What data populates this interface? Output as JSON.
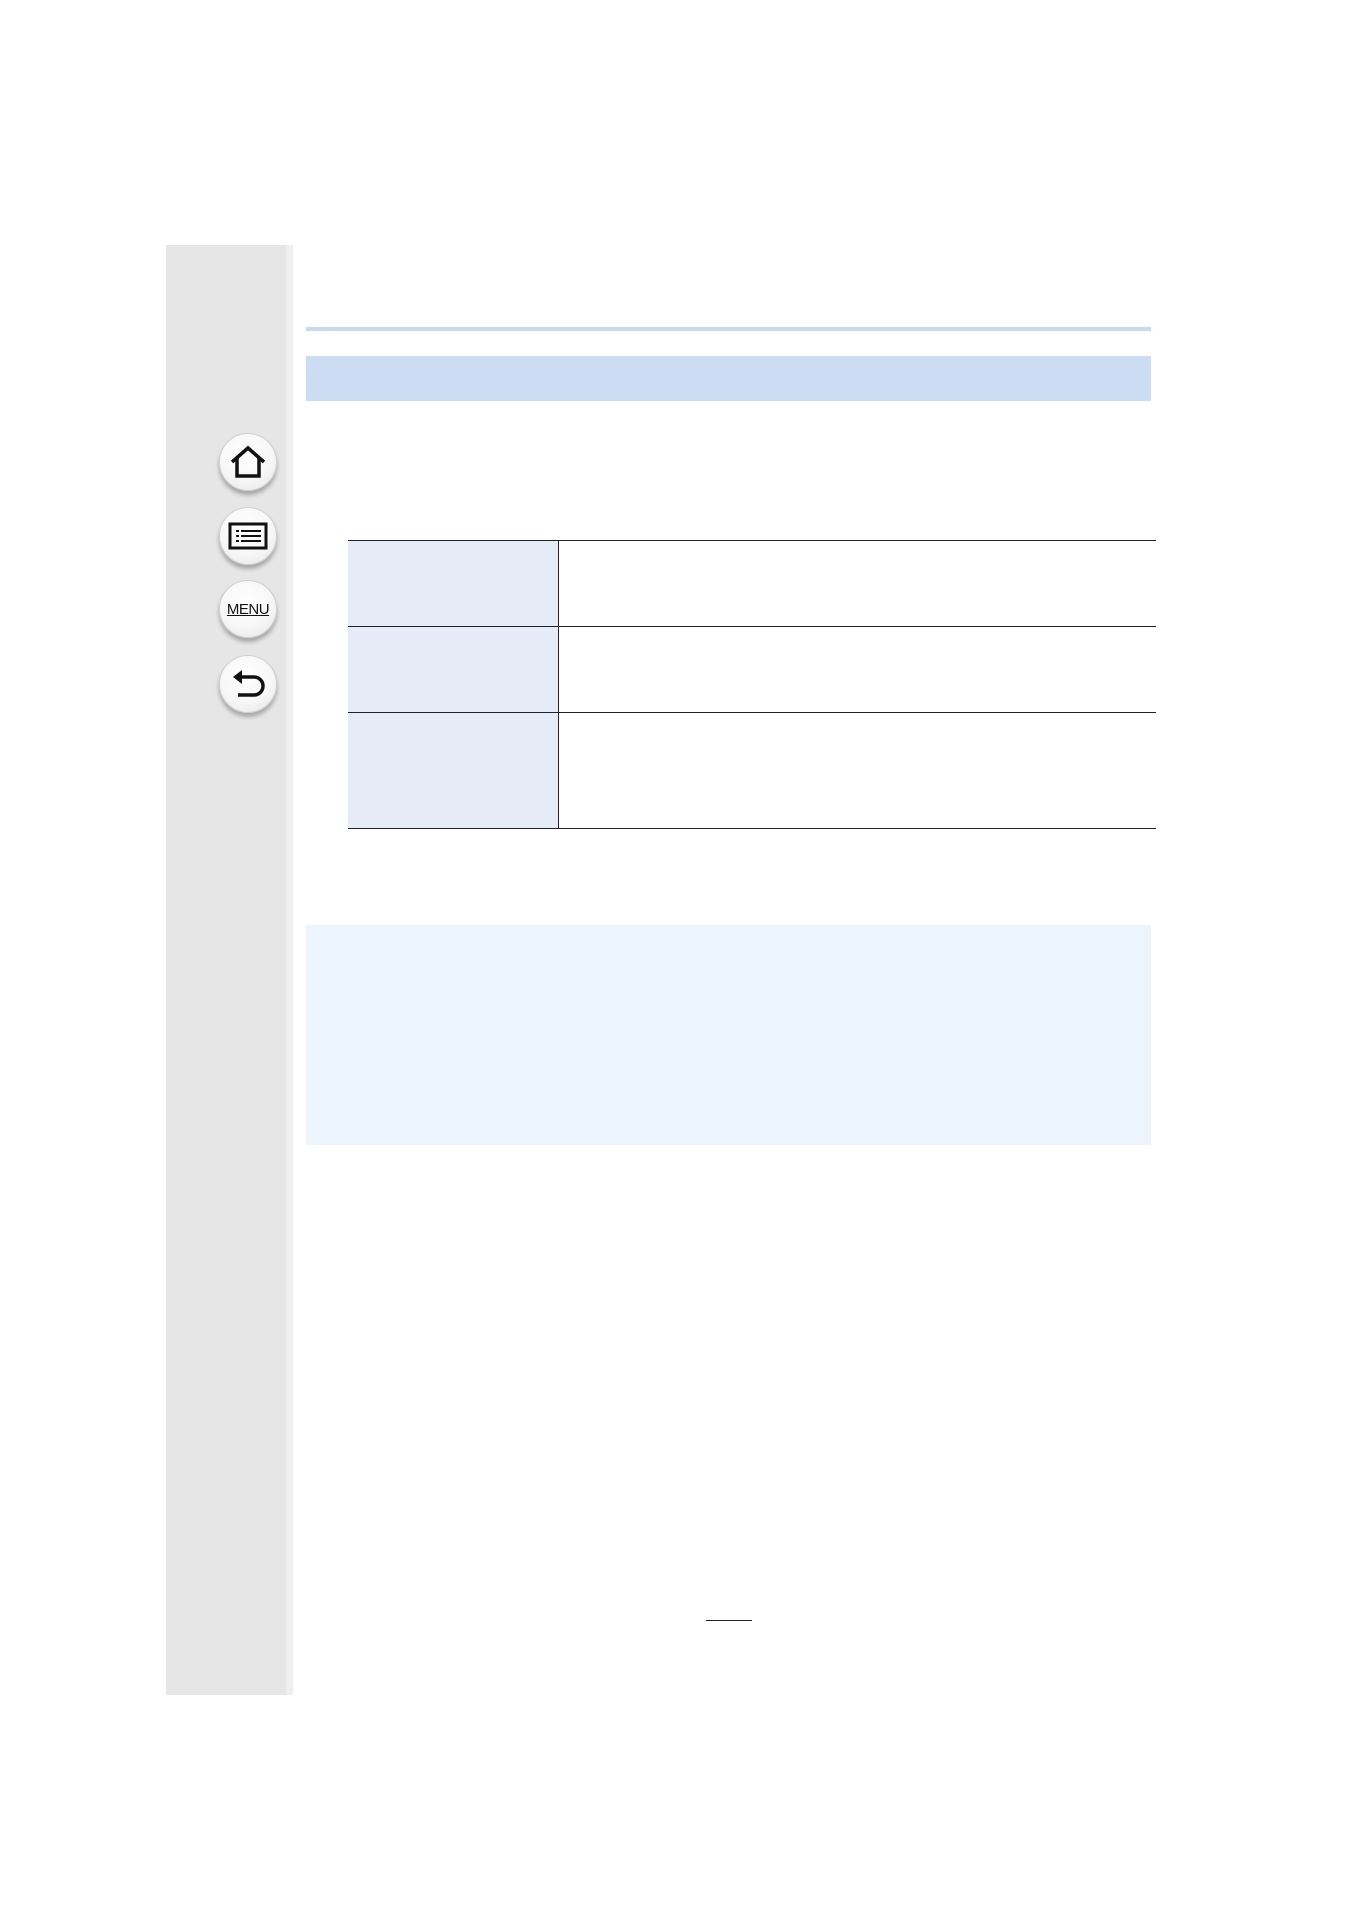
{
  "sidebar": {
    "buttons": [
      {
        "name": "home",
        "icon": "home-icon",
        "label": ""
      },
      {
        "name": "contents",
        "icon": "list-icon",
        "label": ""
      },
      {
        "name": "menu",
        "icon": "menu-icon",
        "label": "MENU"
      },
      {
        "name": "back",
        "icon": "back-arrow-icon",
        "label": ""
      }
    ]
  },
  "colors": {
    "sidebar": "#e6e6e6",
    "section_bar": "#ccdcf3",
    "table_label_cell": "#e5ecf8",
    "note_box": "#ecf4fd",
    "top_rule": "#c8d8ee"
  },
  "section": {
    "title": ""
  },
  "table": {
    "rows": [
      {
        "label": "",
        "description": ""
      },
      {
        "label": "",
        "description": ""
      },
      {
        "label": "",
        "description": ""
      }
    ]
  },
  "note": {
    "text": ""
  },
  "footer": {
    "page_number": ""
  }
}
